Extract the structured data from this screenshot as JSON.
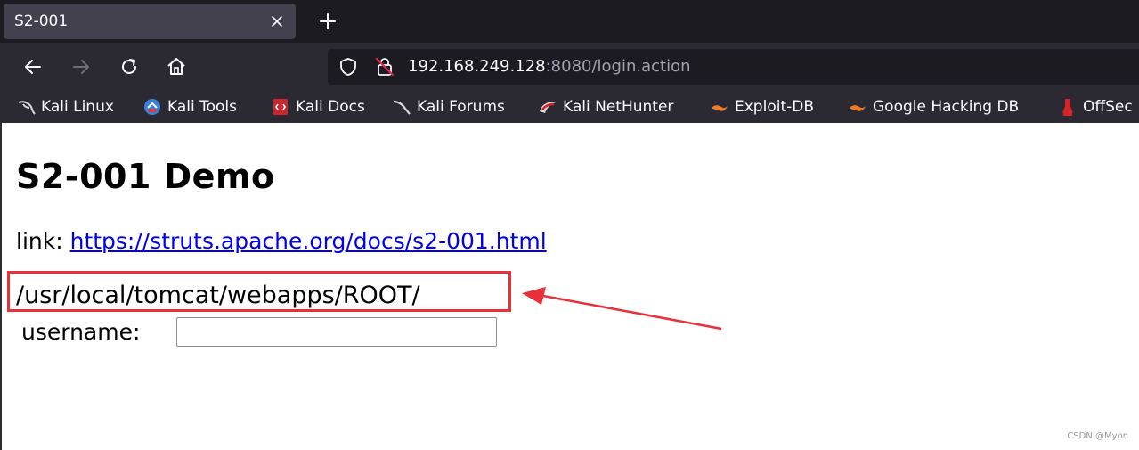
{
  "tab": {
    "title": "S2-001"
  },
  "url": {
    "host": "192.168.249.128",
    "rest": ":8080/login.action"
  },
  "bookmarks": [
    {
      "label": "Kali Linux",
      "icon": "kali-dragon-icon"
    },
    {
      "label": "Kali Tools",
      "icon": "kali-tools-icon"
    },
    {
      "label": "Kali Docs",
      "icon": "kali-docs-icon"
    },
    {
      "label": "Kali Forums",
      "icon": "kali-forums-icon"
    },
    {
      "label": "Kali NetHunter",
      "icon": "nethunter-icon"
    },
    {
      "label": "Exploit-DB",
      "icon": "exploit-db-icon"
    },
    {
      "label": "Google Hacking DB",
      "icon": "ghdb-icon"
    },
    {
      "label": "OffSec",
      "icon": "offsec-icon"
    }
  ],
  "page": {
    "title": "S2-001 Demo",
    "link_prefix": "link:",
    "link_text": "https://struts.apache.org/docs/s2-001.html",
    "path_output": "/usr/local/tomcat/webapps/ROOT/",
    "username_label": "username:"
  },
  "watermark": "CSDN @Myon⁠",
  "colors": {
    "annotation": "#e8303a",
    "link": "#0000ee",
    "chrome_dark": "#1c1b22",
    "chrome": "#2b2a33"
  }
}
